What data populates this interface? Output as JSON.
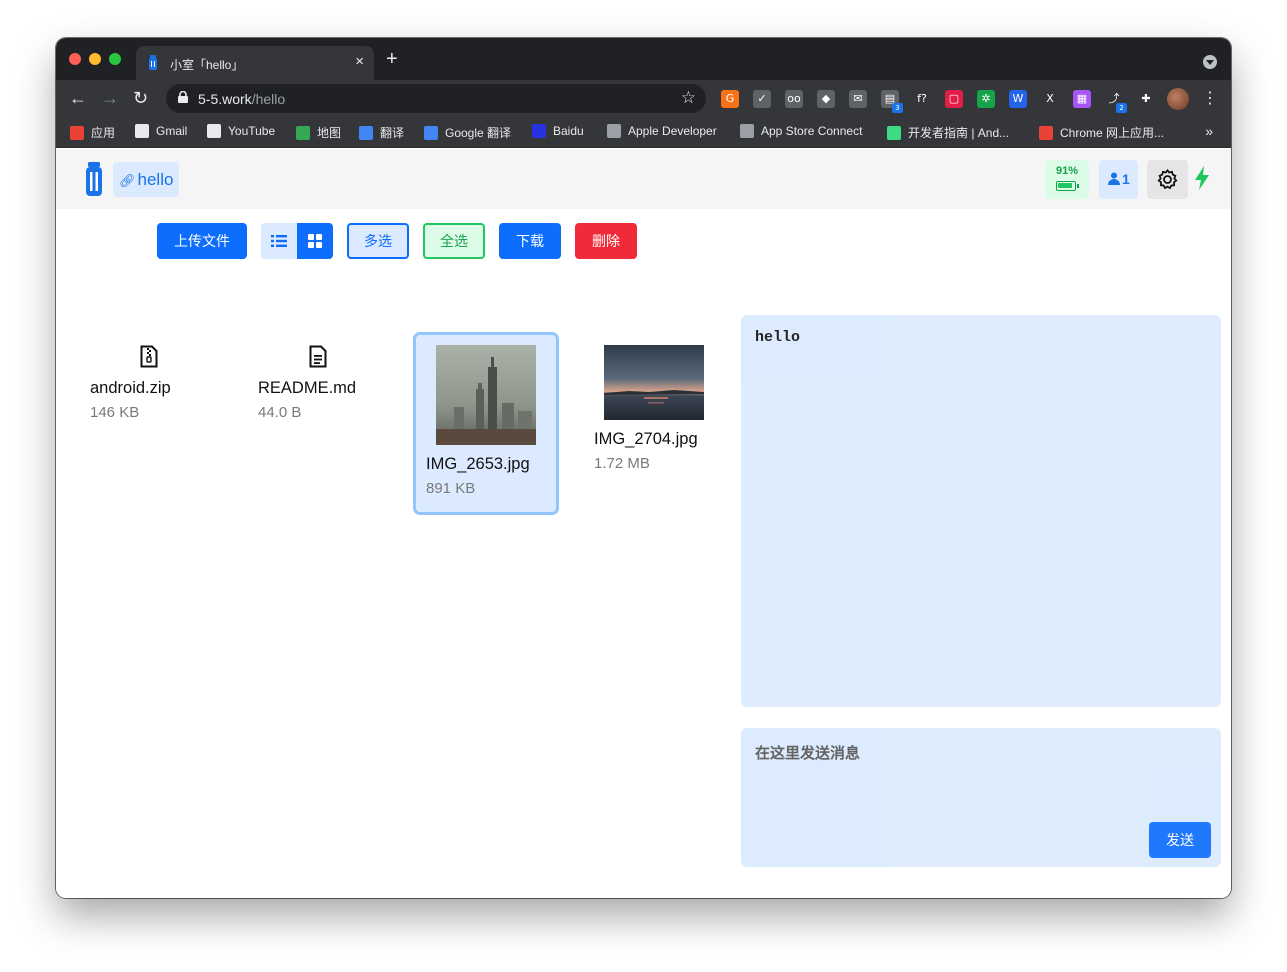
{
  "browser": {
    "tab_title": "小室「hello」",
    "tab_close": "×",
    "new_tab": "+",
    "url_host": "5-5.work",
    "url_path": "/hello",
    "extensions": [
      {
        "name": "G",
        "color": "#f97316"
      },
      {
        "name": "✓",
        "color": "#5f6368"
      },
      {
        "name": "oo",
        "color": "#5f6368"
      },
      {
        "name": "◆",
        "color": "#5f6368"
      },
      {
        "name": "✉",
        "color": "#5f6368"
      },
      {
        "name": "▤",
        "color": "#5f6368",
        "badge": "3"
      },
      {
        "name": "f?",
        "color": "#35363a"
      },
      {
        "name": "▢",
        "color": "#e11d48"
      },
      {
        "name": "✲",
        "color": "#16a34a"
      },
      {
        "name": "W",
        "color": "#2563eb"
      },
      {
        "name": "X",
        "color": "#35363a"
      },
      {
        "name": "▦",
        "color": "#a855f7"
      },
      {
        "name": "⤴",
        "color": "#35363a",
        "badge": "2"
      },
      {
        "name": "✚",
        "color": "#35363a"
      }
    ],
    "bookmarks": [
      {
        "label": "应用",
        "color": "#ea4335"
      },
      {
        "label": "Gmail",
        "color": "#e8eaed"
      },
      {
        "label": "YouTube",
        "color": "#e8eaed"
      },
      {
        "label": "地图",
        "color": "#34a853"
      },
      {
        "label": "翻译",
        "color": "#4285f4"
      },
      {
        "label": "Google 翻译",
        "color": "#4285f4"
      },
      {
        "label": "Baidu",
        "color": "#2932e1"
      },
      {
        "label": "Apple Developer",
        "color": "#9aa0a6"
      },
      {
        "label": "App Store Connect",
        "color": "#9aa0a6"
      },
      {
        "label": "开发者指南 | And...",
        "color": "#3ddc84"
      },
      {
        "label": "Chrome 网上应用...",
        "color": "#ea4335"
      }
    ],
    "bookmarks_more": "»"
  },
  "app": {
    "room_name": "hello",
    "battery": "91%",
    "battery_level": 0.91,
    "user_count": "1",
    "toolbar": {
      "upload": "上传文件",
      "multi_select": "多选",
      "select_all": "全选",
      "download": "下载",
      "delete": "删除"
    },
    "files": [
      {
        "name": "android.zip",
        "size": "146 KB",
        "type": "zip-file-icon"
      },
      {
        "name": "README.md",
        "size": "44.0 B",
        "type": "text-file-icon"
      },
      {
        "name": "IMG_2653.jpg",
        "size": "891 KB",
        "type": "image-thumbnail",
        "selected": true
      },
      {
        "name": "IMG_2704.jpg",
        "size": "1.72 MB",
        "type": "image-thumbnail"
      }
    ],
    "chat": {
      "messages": [
        "hello"
      ],
      "input_placeholder": "在这里发送消息",
      "send": "发送"
    }
  }
}
